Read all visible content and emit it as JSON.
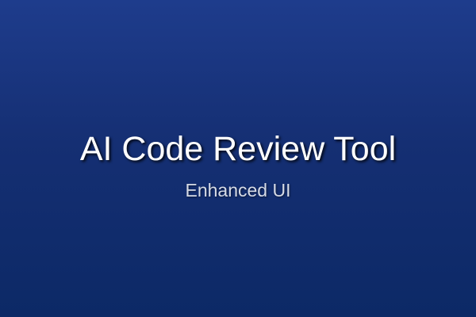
{
  "splash": {
    "title": "AI Code Review Tool",
    "subtitle": "Enhanced UI"
  },
  "colors": {
    "background_top": "#1e3c8c",
    "background_bottom": "#0c2966",
    "title_text": "#ffffff",
    "subtitle_text": "#d6dbe6"
  }
}
